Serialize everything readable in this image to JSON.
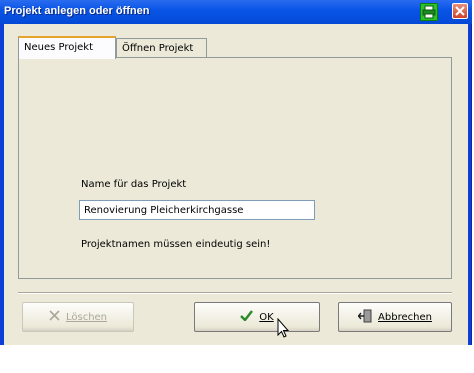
{
  "window": {
    "title": "Projekt anlegen oder öffnen"
  },
  "titlebar_icons": [
    "printer-icon",
    "close-icon"
  ],
  "tabs": [
    {
      "label": "Neues Projekt",
      "active": true
    },
    {
      "label": "Öffnen Projekt",
      "active": false
    }
  ],
  "form": {
    "name_label": "Name für das Projekt",
    "name_value": "Renovierung Pleicherkirchgasse",
    "hint": "Projektnamen müssen eindeutig sein!"
  },
  "buttons": {
    "delete_label": "Löschen",
    "ok_label": "OK",
    "cancel_label": "Abbrechen"
  },
  "colors": {
    "titlebar": "#0a55e6",
    "client_bg": "#ece9d8",
    "tab_highlight": "#e5a42c",
    "ok_check": "#2a8a2a"
  }
}
